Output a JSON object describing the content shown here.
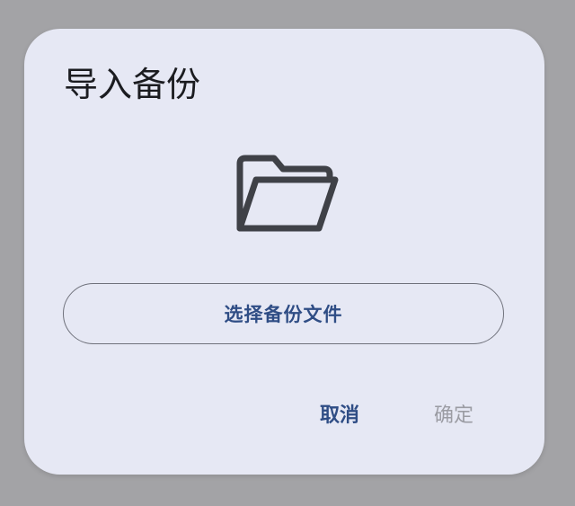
{
  "dialog": {
    "title": "导入备份",
    "icon": "folder-open-icon",
    "choose_file_label": "选择备份文件",
    "cancel_label": "取消",
    "confirm_label": "确定"
  },
  "colors": {
    "backdrop": "#a3a3a6",
    "dialog_background": "#e6e8f4",
    "title_text": "#1b1c20",
    "icon": "#3f4147",
    "accent": "#2f4d85",
    "button_outline": "#6f717b",
    "disabled_text": "#9b9ca3"
  }
}
